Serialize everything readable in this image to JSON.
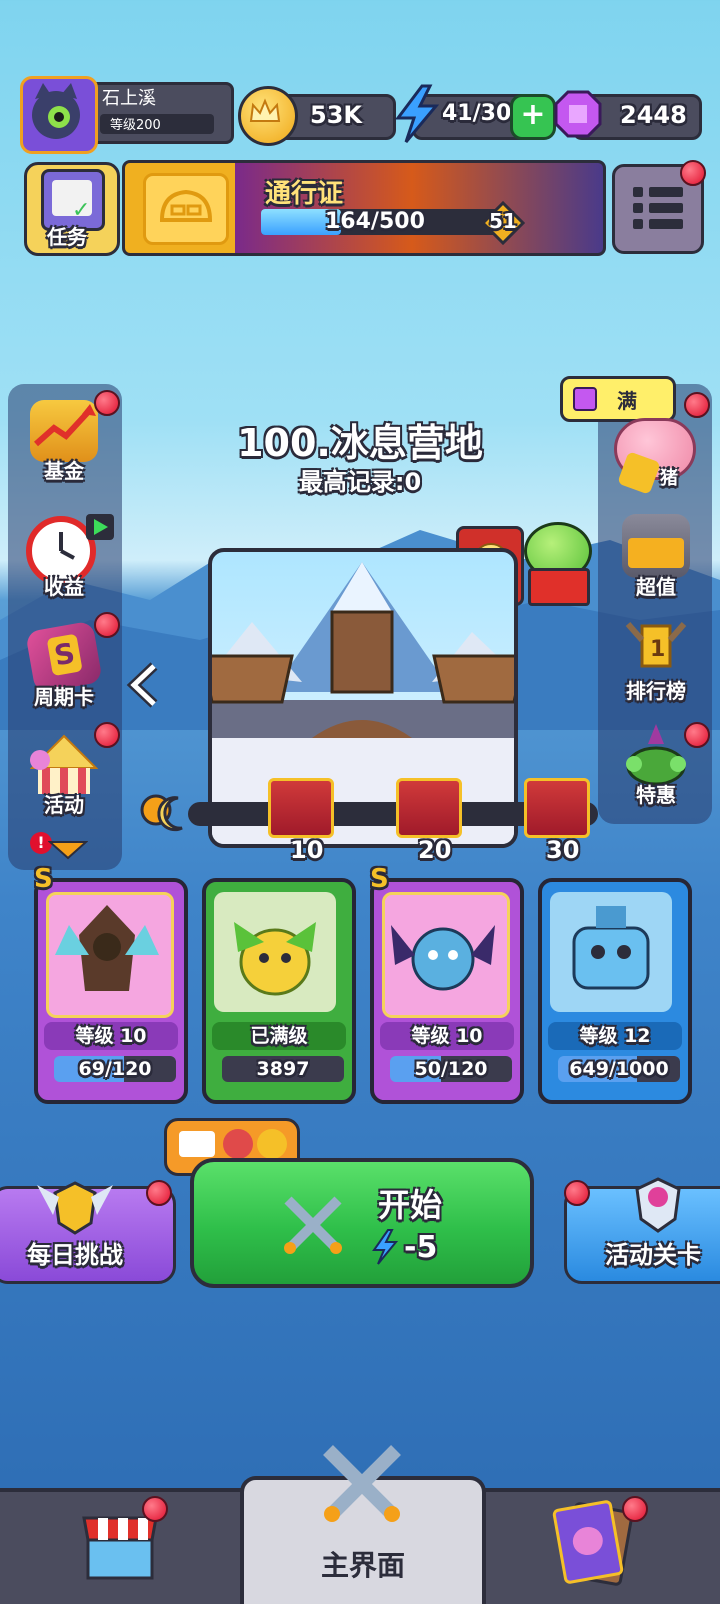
{
  "player": {
    "name": "石上溪",
    "level_label": "等级200"
  },
  "currencies": {
    "crowns": "53K",
    "energy": "41/30",
    "gems": "2448"
  },
  "top_buttons": {
    "tasks_label": "任务"
  },
  "pass": {
    "title": "通行证",
    "progress_text": "164/500",
    "progress_fraction": 0.328,
    "level": "51"
  },
  "stage": {
    "title": "100.冰息营地",
    "best_record": "最高记录:0"
  },
  "left_menu": [
    {
      "label": "基金"
    },
    {
      "label": "收益"
    },
    {
      "label": "周期卡"
    },
    {
      "label": "活动"
    }
  ],
  "right_menu": {
    "piggy_badge": "满",
    "piggy_label": "猪",
    "items": [
      {
        "label": "超值"
      },
      {
        "label": "排行榜"
      },
      {
        "label": "特惠"
      }
    ]
  },
  "rewards": [
    {
      "value": "10"
    },
    {
      "value": "20"
    },
    {
      "value": "30"
    }
  ],
  "heroes": [
    {
      "rank": "S",
      "level": "等级 10",
      "progress": "69/120",
      "progress_fraction": 0.575
    },
    {
      "rank": "",
      "level": "已满级",
      "progress": "3897",
      "progress_fraction": 1.0
    },
    {
      "rank": "S",
      "level": "等级 10",
      "progress": "50/120",
      "progress_fraction": 0.417
    },
    {
      "rank": "",
      "level": "等级 12",
      "progress": "649/1000",
      "progress_fraction": 0.649
    }
  ],
  "actions": {
    "daily": "每日挑战",
    "start": "开始",
    "start_cost": "-5",
    "event_stage": "活动关卡"
  },
  "bottom_nav": {
    "main": "主界面"
  },
  "colors": {
    "accent_green": "#2fbf4a",
    "energy_blue": "#2c8ef0",
    "gem_purple": "#b04adf",
    "gold": "#f5c028",
    "badge_red": "#e0102e"
  }
}
